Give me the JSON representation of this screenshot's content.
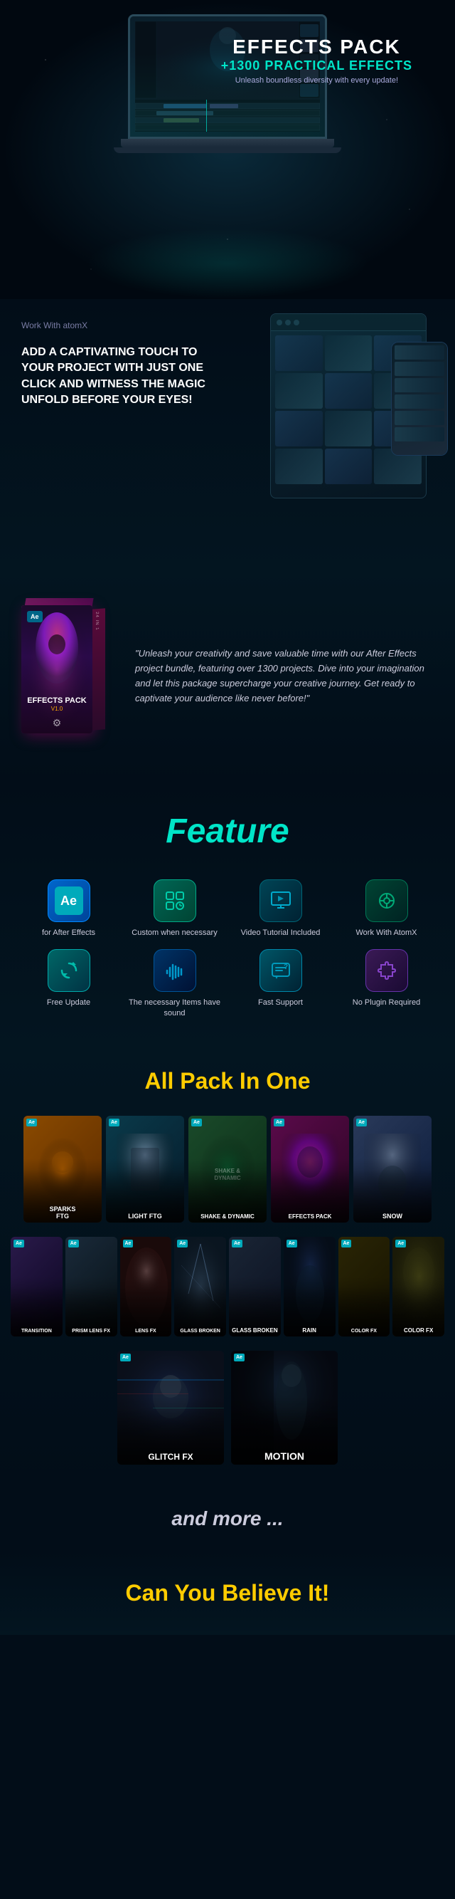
{
  "hero": {
    "title": "EFFECTS PACK",
    "subtitle": "+1300 PRACTICAL EFFECTS",
    "tagline": "Unleash boundless diversity with every update!"
  },
  "atomx": {
    "label": "Work With atomX",
    "heading": "ADD A CAPTIVATING TOUCH TO YOUR PROJECT WITH JUST ONE CLICK AND WITNESS THE MAGIC UNFOLD BEFORE YOUR EYES!"
  },
  "product": {
    "box_label_top": "EFFECTS PACK",
    "box_label_title": "EFFECTS PACK",
    "box_version": "V1.0",
    "box_side_label": "24 IN 1",
    "quote": "\"Unleash your creativity and save valuable time with our After Effects project bundle, featuring over 1300 projects. Dive into your imagination and let this package supercharge your creative journey. Get ready to captivate your audience like never before!\""
  },
  "feature": {
    "section_title": "Feature",
    "items": [
      {
        "label": "for After Effects",
        "icon": "Ae",
        "icon_type": "ae"
      },
      {
        "label": "Custom when necessary",
        "icon": "⚙",
        "icon_type": "teal"
      },
      {
        "label": "Video Tutorial Included",
        "icon": "🖥",
        "icon_type": "dark-teal"
      },
      {
        "label": "Work With AtomX",
        "icon": "🔧",
        "icon_type": "dark-green"
      },
      {
        "label": "Free Update",
        "icon": "♻",
        "icon_type": "teal2"
      },
      {
        "label": "The necessary Items have sound",
        "icon": "🎵",
        "icon_type": "dark-blue"
      },
      {
        "label": "Fast Support",
        "icon": "💬",
        "icon_type": "medium-teal"
      },
      {
        "label": "No Plugin Required",
        "icon": "🧩",
        "icon_type": "purple"
      }
    ]
  },
  "allpack": {
    "title": "All Pack In One",
    "packs_row1": [
      {
        "label": "SPARKS FTG",
        "class": "pb1"
      },
      {
        "label": "LIGHT FTG",
        "class": "pb2"
      },
      {
        "label": "SHAKE & DYNAMIC",
        "class": "pb3"
      },
      {
        "label": "EFFECTS PACK",
        "class": "pb4"
      },
      {
        "label": "SNOW",
        "class": "pb5"
      }
    ],
    "packs_row2": [
      {
        "label": "TRANSITION",
        "class": "pb-transition"
      },
      {
        "label": "PRISM LENS FX",
        "class": "pb-prism"
      },
      {
        "label": "LENS FX",
        "class": "pb-lens"
      },
      {
        "label": "GLASS BROKEN",
        "class": "pb-glass"
      },
      {
        "label": "GLASS BROKEN",
        "class": "pb-glassbroke"
      },
      {
        "label": "RAIN",
        "class": "pb-rain"
      },
      {
        "label": "COLOR FX",
        "class": "pb-color"
      },
      {
        "label": "COLOR FX",
        "class": "pb-colorfx"
      }
    ],
    "packs_row3": [
      {
        "label": "GLITCH FX",
        "class": "pb-glitch"
      },
      {
        "label": "MOTION",
        "class": "pb-motion"
      }
    ]
  },
  "andmore": {
    "text": "and more ..."
  },
  "believe": {
    "title": "Can You Believe It!"
  }
}
